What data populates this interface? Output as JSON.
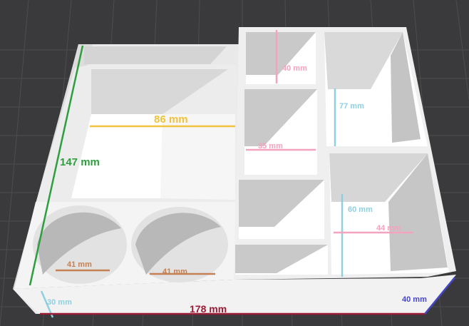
{
  "colors": {
    "background": "#3a3a3c",
    "grid": "#4d4d50",
    "box_wall": "#f3f3f3",
    "box_floor": "#ffffff",
    "shadow": "#c9c9c9",
    "green": "#2e9e3e",
    "yellow": "#f2c23a",
    "pink": "#f4a3bd",
    "cyan": "#8fd0e0",
    "brown": "#c58053",
    "crimson": "#9b1b37",
    "blue": "#4646c8"
  },
  "dimensions": {
    "depth": "147 mm",
    "tray_width": "86 mm",
    "top_small_compartment": "40 mm",
    "middle_compartment": "35 mm",
    "right_tall_compartment": "77 mm",
    "right_lower_compartment": "60 mm",
    "right_lower_width": "44 mm",
    "cup_left": "41 mm",
    "cup_right": "41 mm",
    "wall_height": "30 mm",
    "total_width": "178 mm",
    "corner_height": "40 mm"
  }
}
